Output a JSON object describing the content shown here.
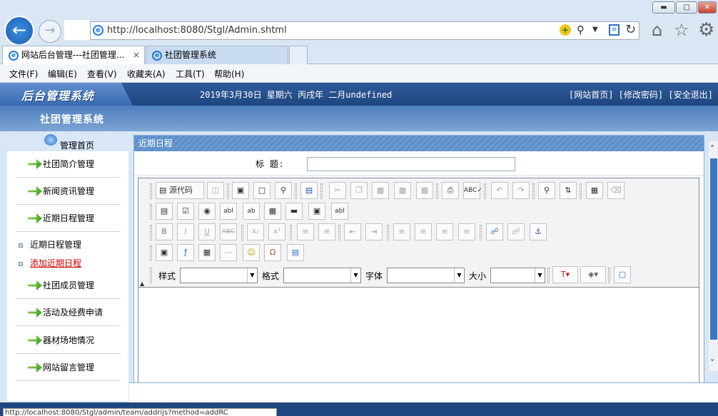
{
  "browser": {
    "url": "http://localhost:8080/Stgl/Admin.shtml",
    "tabs": [
      {
        "label": "网站后台管理---社团管理...",
        "close": "×"
      },
      {
        "label": "社团管理系统"
      }
    ],
    "menu": [
      "文件(F)",
      "编辑(E)",
      "查看(V)",
      "收藏夹(A)",
      "工具(T)",
      "帮助(H)"
    ],
    "status_url": "http://localhost:8080/Stgl/admin/team/addrijs?method=addRC"
  },
  "header": {
    "logo": "后台管理系统",
    "date": "2019年3月30日 星期六 丙戌年 二月undefined",
    "links": "[网站首页] [修改密码] [安全退出]",
    "system_name": "社团管理系统"
  },
  "sidebar": {
    "home": "管理首页",
    "items": [
      {
        "label": "社团简介管理"
      },
      {
        "label": "新闻资讯管理"
      },
      {
        "label": "近期日程管理"
      }
    ],
    "sub_items": [
      {
        "label": "近期日程管理",
        "color": "#000000"
      },
      {
        "label": "添加近期日程",
        "color": "#cc0000"
      }
    ],
    "items_after": [
      {
        "label": "社团成员管理"
      },
      {
        "label": "活动及经费申请"
      },
      {
        "label": "器材场地情况"
      },
      {
        "label": "网站留言管理"
      }
    ]
  },
  "main": {
    "panel_title": "近期日程",
    "title_label": "标  题:",
    "title_value": "",
    "editor": {
      "source_button": "源代码",
      "style_label": "样式",
      "format_label": "格式",
      "font_label": "字体",
      "size_label": "大小"
    }
  },
  "colors": {
    "header": "#1f467f",
    "accent": "#3c78c4",
    "link_red": "#cc0000"
  }
}
